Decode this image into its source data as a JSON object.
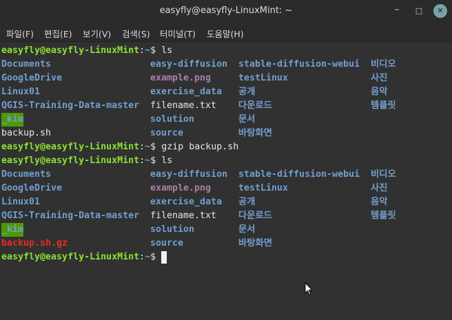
{
  "window": {
    "title": "easyfly@easyfly-LinuxMint: ~",
    "controls": {
      "minimize": "–",
      "maximize": "□",
      "close": "✕"
    }
  },
  "menu": [
    "파일(F)",
    "편집(E)",
    "보기(V)",
    "검색(S)",
    "터미널(T)",
    "도움말(H)"
  ],
  "colors": {
    "prompt_user": "#8ae234",
    "prompt_path": "#729fcf",
    "directory": "#729fcf",
    "image_file": "#ad7fa8",
    "archive": "#ef2929",
    "sticky_dir_bg": "#4e9a06",
    "background": "#313131"
  },
  "terminal": {
    "prompt": {
      "user_host": "easyfly@easyfly-LinuxMint",
      "path": "~",
      "symbol": "$"
    },
    "commands": [
      "ls",
      "gzip backup.sh",
      "ls"
    ],
    "listing1": [
      [
        {
          "t": "Documents",
          "k": "dir"
        },
        {
          "t": "easy-diffusion",
          "k": "dir"
        },
        {
          "t": "stable-diffusion-webui",
          "k": "dir"
        },
        {
          "t": "비디오",
          "k": "dir"
        }
      ],
      [
        {
          "t": "GoogleDrive",
          "k": "dir"
        },
        {
          "t": "example.png",
          "k": "img"
        },
        {
          "t": "testLinux",
          "k": "dir"
        },
        {
          "t": "사진",
          "k": "dir"
        }
      ],
      [
        {
          "t": "Linux01",
          "k": "dir"
        },
        {
          "t": "exercise_data",
          "k": "dir"
        },
        {
          "t": "공개",
          "k": "dir"
        },
        {
          "t": "음악",
          "k": "dir"
        }
      ],
      [
        {
          "t": "QGIS-Training-Data-master",
          "k": "dir"
        },
        {
          "t": "filename.txt",
          "k": "file"
        },
        {
          "t": "다운로드",
          "k": "dir"
        },
        {
          "t": "템플릿",
          "k": "dir"
        }
      ],
      [
        {
          "t": "_kim",
          "k": "sticky"
        },
        {
          "t": "solution",
          "k": "dir"
        },
        {
          "t": "문서",
          "k": "dir"
        },
        {
          "t": "",
          "k": "file"
        }
      ],
      [
        {
          "t": "backup.sh",
          "k": "file"
        },
        {
          "t": "source",
          "k": "dir"
        },
        {
          "t": "바탕화면",
          "k": "dir"
        },
        {
          "t": "",
          "k": "file"
        }
      ]
    ],
    "listing2": [
      [
        {
          "t": "Documents",
          "k": "dir"
        },
        {
          "t": "easy-diffusion",
          "k": "dir"
        },
        {
          "t": "stable-diffusion-webui",
          "k": "dir"
        },
        {
          "t": "비디오",
          "k": "dir"
        }
      ],
      [
        {
          "t": "GoogleDrive",
          "k": "dir"
        },
        {
          "t": "example.png",
          "k": "img"
        },
        {
          "t": "testLinux",
          "k": "dir"
        },
        {
          "t": "사진",
          "k": "dir"
        }
      ],
      [
        {
          "t": "Linux01",
          "k": "dir"
        },
        {
          "t": "exercise_data",
          "k": "dir"
        },
        {
          "t": "공개",
          "k": "dir"
        },
        {
          "t": "음악",
          "k": "dir"
        }
      ],
      [
        {
          "t": "QGIS-Training-Data-master",
          "k": "dir"
        },
        {
          "t": "filename.txt",
          "k": "file"
        },
        {
          "t": "다운로드",
          "k": "dir"
        },
        {
          "t": "템플릿",
          "k": "dir"
        }
      ],
      [
        {
          "t": "_kim",
          "k": "sticky"
        },
        {
          "t": "solution",
          "k": "dir"
        },
        {
          "t": "문서",
          "k": "dir"
        },
        {
          "t": "",
          "k": "file"
        }
      ],
      [
        {
          "t": "backup.sh.gz",
          "k": "arch"
        },
        {
          "t": "source",
          "k": "dir"
        },
        {
          "t": "바탕화면",
          "k": "dir"
        },
        {
          "t": "",
          "k": "file"
        }
      ]
    ]
  }
}
